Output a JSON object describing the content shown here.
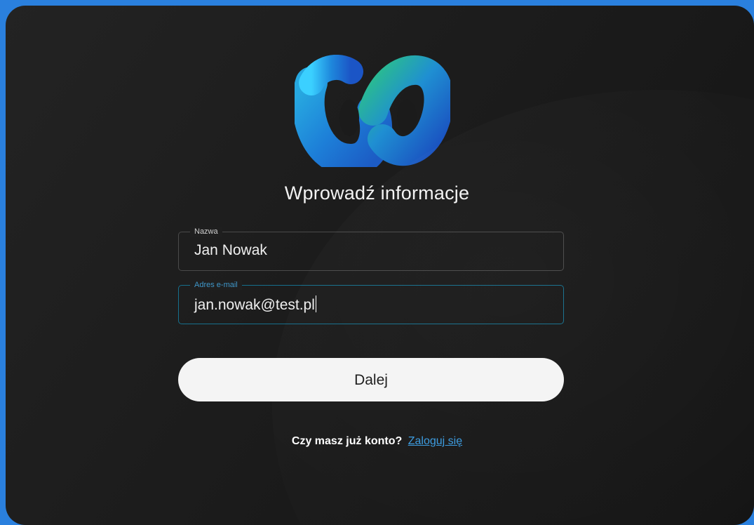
{
  "form": {
    "title": "Wprowadź informacje",
    "name_field": {
      "label": "Nazwa",
      "value": "Jan Nowak"
    },
    "email_field": {
      "label": "Adres e-mail",
      "value": "jan.nowak@test.pl"
    },
    "next_button": "Dalej",
    "signin_prompt": "Czy masz już konto?",
    "signin_link": "Zaloguj się"
  },
  "colors": {
    "page_background": "#2a80de",
    "window_background": "#1e1e1e",
    "focus_border": "#16708e",
    "link": "#3a9be0",
    "button_background": "#f4f4f4"
  },
  "icons": {
    "logo": "webex-logo-icon"
  }
}
